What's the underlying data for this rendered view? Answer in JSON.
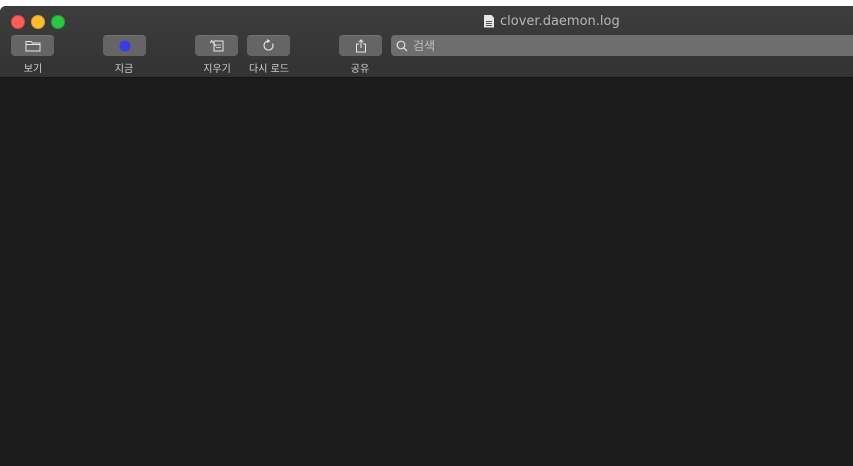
{
  "window": {
    "title": "clover.daemon.log"
  },
  "toolbar": {
    "view_label": "보기",
    "now_label": "지금",
    "clear_label": "지우기",
    "reload_label": "다시 로드",
    "share_label": "공유"
  },
  "search": {
    "placeholder": "검색"
  },
  "colors": {
    "now_indicator": "#3a3ae6",
    "close": "#fe5f57",
    "minimize": "#febc2e",
    "maximize": "#28c840"
  }
}
